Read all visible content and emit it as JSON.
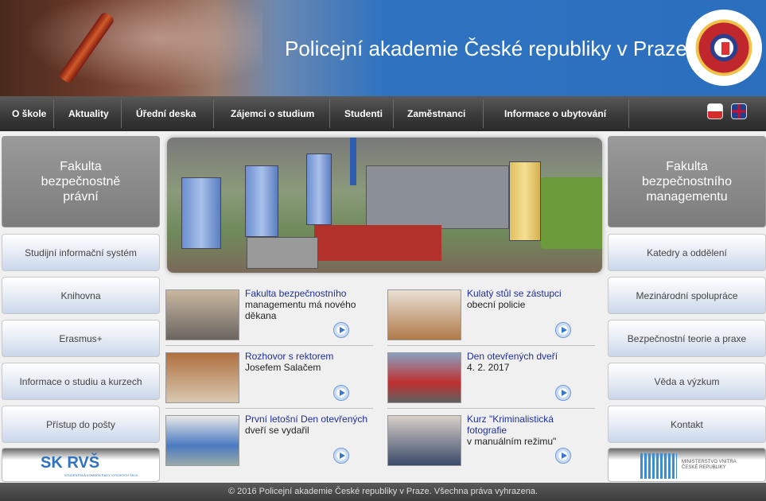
{
  "header": {
    "title": "Policejní akademie České republiky v Praze"
  },
  "nav": {
    "items": [
      "O škole",
      "Aktuality",
      "Úřední deska",
      "Zájemci o studium",
      "Studenti",
      "Zaměstnanci",
      "Informace o ubytování"
    ]
  },
  "left": {
    "faculty": "Fakulta bezpečnostně právní",
    "buttons": [
      "Studijní informační systém",
      "Knihovna",
      "Erasmus+",
      "Informace o studiu a kurzech",
      "Přístup do pošty"
    ],
    "logo_text": "SK RVŠ",
    "logo_subtext": "STUDENTSKÁ KOMORA RADY VYSOKÝCH ŠKOL"
  },
  "right": {
    "faculty": "Fakulta bezpečnostního managementu",
    "buttons": [
      "Katedry a oddělení",
      "Mezinárodní spolupráce",
      "Bezpečnostní teorie a praxe",
      "Věda a výzkum",
      "Kontakt"
    ],
    "logo_text": "MINISTERSTVO VNITRA ČESKÉ REPUBLIKY"
  },
  "news": [
    {
      "line1": "Fakulta bezpečnostního",
      "line2": "managementu má nového",
      "line3": "děkana"
    },
    {
      "line1": "Kulatý stůl se zástupci",
      "line2": "obecní policie",
      "line3": ""
    },
    {
      "line1": "Rozhovor s rektorem",
      "line2": "Josefem Salačem",
      "line3": ""
    },
    {
      "line1": "Den otevřených dveří",
      "line2": "4. 2. 2017",
      "line3": ""
    },
    {
      "line1": "První letošní Den otevřených",
      "line2": "dveří se vydařil",
      "line3": ""
    },
    {
      "line1": "Kurz \"Kriminalistická fotografie",
      "line2": "v manuálním režimu\"",
      "line3": ""
    }
  ],
  "footer": {
    "text": "© 2016 Policejní akademie České republiky v Praze. Všechna práva vyhrazena."
  }
}
